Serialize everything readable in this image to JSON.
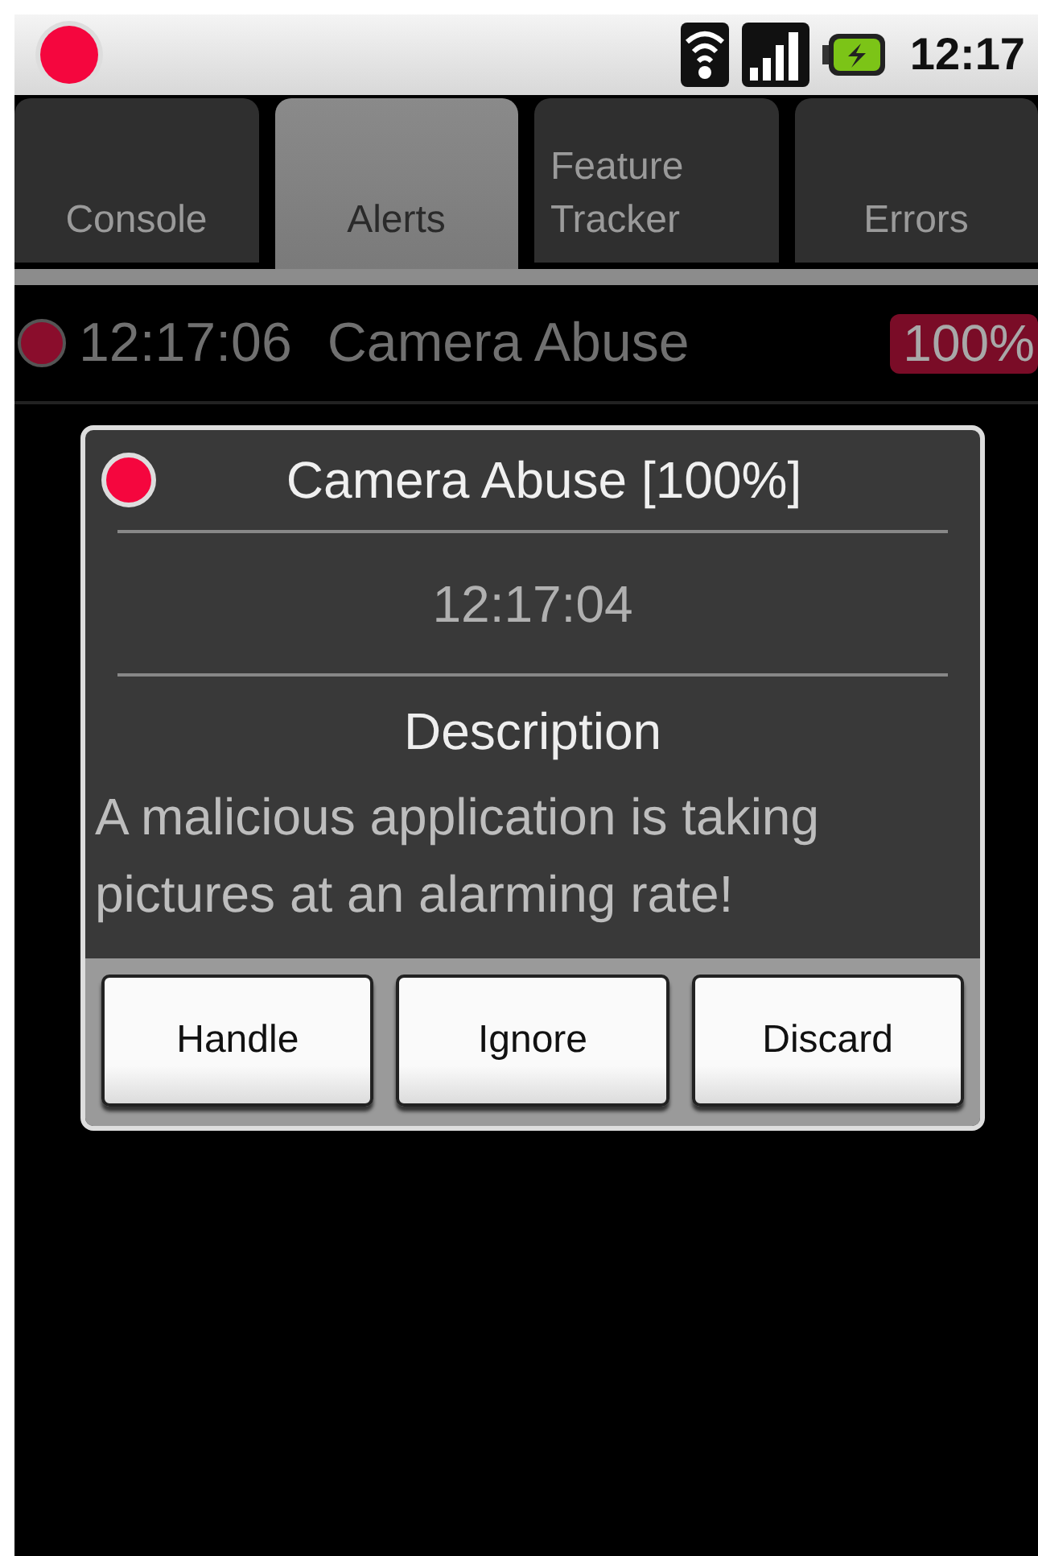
{
  "status_bar": {
    "time": "12:17"
  },
  "tabs": [
    {
      "label": "Console",
      "selected": false
    },
    {
      "label": "Alerts",
      "selected": true
    },
    {
      "label": "Feature Tracker",
      "selected": false
    },
    {
      "label": "Errors",
      "selected": false
    }
  ],
  "alerts": [
    {
      "time": "12:17:06",
      "title": "Camera Abuse",
      "severity": "100%"
    }
  ],
  "dialog": {
    "title": "Camera Abuse [100%]",
    "time": "12:17:04",
    "heading": "Description",
    "text": "A malicious application is taking pictures at an alarming rate!",
    "buttons": [
      "Handle",
      "Ignore",
      "Discard"
    ]
  }
}
